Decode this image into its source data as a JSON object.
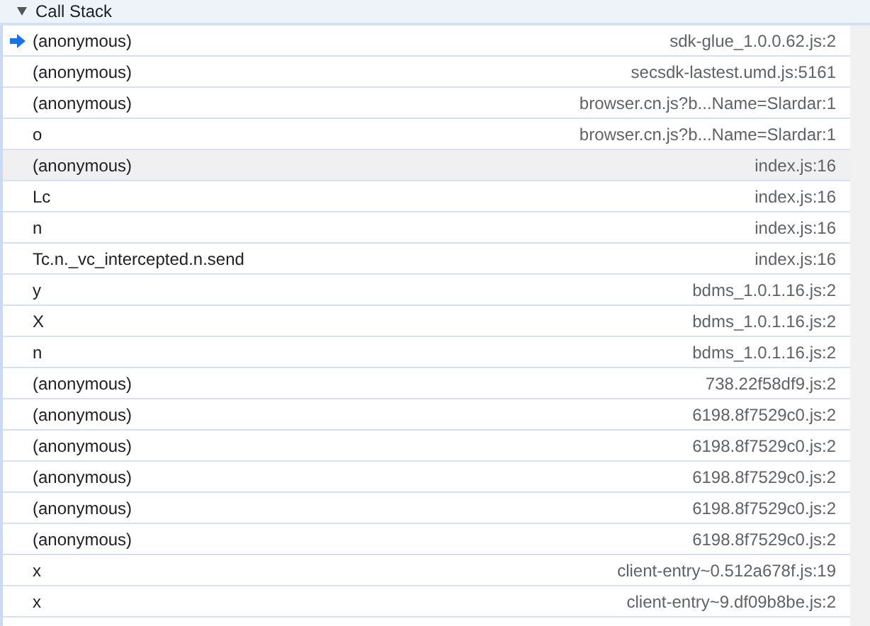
{
  "section": {
    "title": "Call Stack",
    "expanded": true
  },
  "frames": [
    {
      "name": "(anonymous)",
      "location": "sdk-glue_1.0.0.62.js:2",
      "current": true,
      "hovered": false
    },
    {
      "name": "(anonymous)",
      "location": "secsdk-lastest.umd.js:5161",
      "current": false,
      "hovered": false
    },
    {
      "name": "(anonymous)",
      "location": "browser.cn.js?b...Name=Slardar:1",
      "current": false,
      "hovered": false
    },
    {
      "name": "o",
      "location": "browser.cn.js?b...Name=Slardar:1",
      "current": false,
      "hovered": false
    },
    {
      "name": "(anonymous)",
      "location": "index.js:16",
      "current": false,
      "hovered": true
    },
    {
      "name": "Lc",
      "location": "index.js:16",
      "current": false,
      "hovered": false
    },
    {
      "name": "n",
      "location": "index.js:16",
      "current": false,
      "hovered": false
    },
    {
      "name": "Tc.n._vc_intercepted.n.send",
      "location": "index.js:16",
      "current": false,
      "hovered": false
    },
    {
      "name": "y",
      "location": "bdms_1.0.1.16.js:2",
      "current": false,
      "hovered": false
    },
    {
      "name": "X",
      "location": "bdms_1.0.1.16.js:2",
      "current": false,
      "hovered": false
    },
    {
      "name": "n",
      "location": "bdms_1.0.1.16.js:2",
      "current": false,
      "hovered": false
    },
    {
      "name": "(anonymous)",
      "location": "738.22f58df9.js:2",
      "current": false,
      "hovered": false
    },
    {
      "name": "(anonymous)",
      "location": "6198.8f7529c0.js:2",
      "current": false,
      "hovered": false
    },
    {
      "name": "(anonymous)",
      "location": "6198.8f7529c0.js:2",
      "current": false,
      "hovered": false
    },
    {
      "name": "(anonymous)",
      "location": "6198.8f7529c0.js:2",
      "current": false,
      "hovered": false
    },
    {
      "name": "(anonymous)",
      "location": "6198.8f7529c0.js:2",
      "current": false,
      "hovered": false
    },
    {
      "name": "(anonymous)",
      "location": "6198.8f7529c0.js:2",
      "current": false,
      "hovered": false
    },
    {
      "name": "x",
      "location": "client-entry~0.512a678f.js:19",
      "current": false,
      "hovered": false
    },
    {
      "name": "x",
      "location": "client-entry~9.df09b8be.js:2",
      "current": false,
      "hovered": false
    }
  ]
}
